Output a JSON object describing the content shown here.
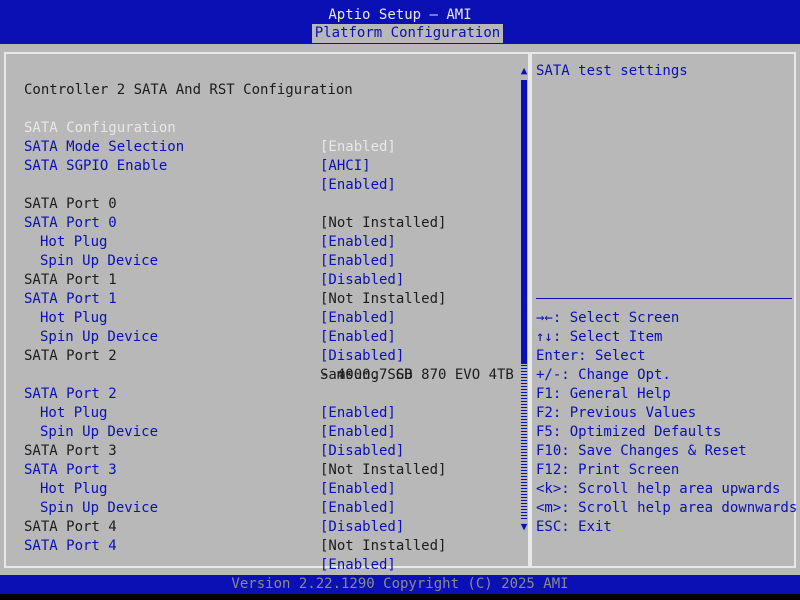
{
  "header": {
    "title": "Aptio Setup – AMI",
    "tab": "Platform Configuration"
  },
  "colors": {
    "header_bg": "#0a10b4",
    "panel_bg": "#b8b8b8",
    "selected_text": "#e8e8e8",
    "option_text": "#0a10b4",
    "static_text": "#1c1c1c"
  },
  "section_title": "Controller 2 SATA And RST Configuration",
  "items": [
    {
      "label": "SATA Configuration",
      "value": "[Enabled]"
    },
    {
      "label": "SATA Mode Selection",
      "value": "[AHCI]"
    },
    {
      "label": "SATA SGPIO Enable",
      "value": "[Enabled]"
    },
    {
      "label": "SATA Port 0",
      "value": "[Not Installed]"
    },
    {
      "label": "SATA Port 0",
      "value": "[Enabled]"
    },
    {
      "label": "Hot Plug",
      "value": "[Enabled]"
    },
    {
      "label": "Spin Up Device",
      "value": "[Disabled]"
    },
    {
      "label": "SATA Port 1",
      "value": "[Not Installed]"
    },
    {
      "label": "SATA Port 1",
      "value": "[Enabled]"
    },
    {
      "label": "Hot Plug",
      "value": "[Enabled]"
    },
    {
      "label": "Spin Up Device",
      "value": "[Disabled]"
    },
    {
      "label": "SATA Port 2",
      "value": "Samsung SSD 870 EVO 4TB",
      "value_cont": "- 4000.7 GB"
    },
    {
      "label": "SATA Port 2",
      "value": "[Enabled]"
    },
    {
      "label": "Hot Plug",
      "value": "[Enabled]"
    },
    {
      "label": "Spin Up Device",
      "value": "[Disabled]"
    },
    {
      "label": "SATA Port 3",
      "value": "[Not Installed]"
    },
    {
      "label": "SATA Port 3",
      "value": "[Enabled]"
    },
    {
      "label": "Hot Plug",
      "value": "[Enabled]"
    },
    {
      "label": "Spin Up Device",
      "value": "[Disabled]"
    },
    {
      "label": "SATA Port 4",
      "value": "[Not Installed]"
    },
    {
      "label": "SATA Port 4",
      "value": "[Enabled]"
    }
  ],
  "scrollbar": {
    "up_icon": "▲",
    "down_icon": "▼"
  },
  "help": {
    "text": "SATA test settings"
  },
  "keys": [
    "→←: Select Screen",
    "↑↓: Select Item",
    "Enter: Select",
    "+/-: Change Opt.",
    "F1: General Help",
    "F2: Previous Values",
    "F5: Optimized Defaults",
    "F10: Save Changes & Reset",
    "F12: Print Screen",
    "<k>: Scroll help area upwards",
    "<m>: Scroll help area downwards",
    "ESC: Exit"
  ],
  "footer": {
    "version": "Version 2.22.1290 Copyright (C) 2025 AMI"
  }
}
